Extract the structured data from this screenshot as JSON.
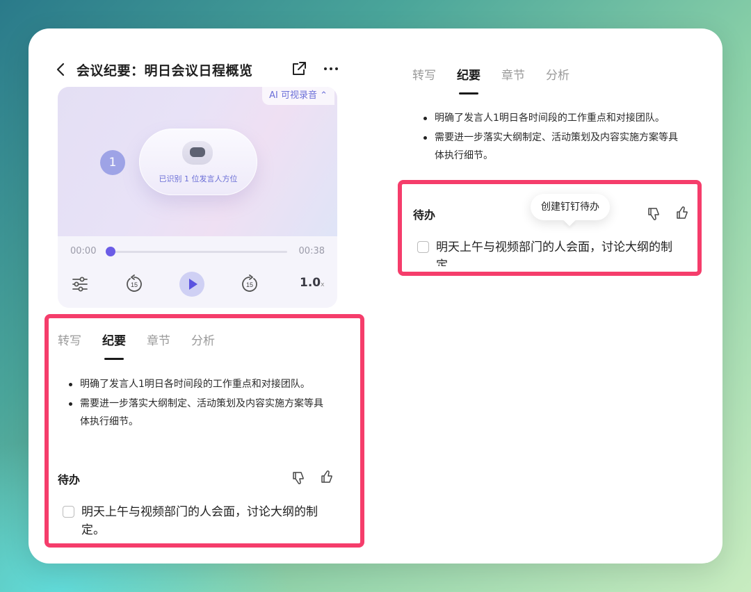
{
  "header": {
    "title": "会议纪要：明日会议日程概览"
  },
  "player": {
    "ai_chip": "AI 可视录音 ⌃",
    "speaker_number": "1",
    "speaker_status": "已识别 1 位发言人方位",
    "time_current": "00:00",
    "time_total": "00:38",
    "progress_fraction": 0.0,
    "speed": "1.0",
    "speed_unit": "x",
    "skip_back_seconds": "15",
    "skip_forward_seconds": "15"
  },
  "tabs": [
    "转写",
    "纪要",
    "章节",
    "分析"
  ],
  "active_tab": "纪要",
  "summary": {
    "bullets": [
      "明确了发言人1明日各时间段的工作重点和对接团队。",
      "需要进一步落实大纲制定、活动策划及内容实施方案等具体执行细节。"
    ]
  },
  "todo": {
    "heading": "待办",
    "item": "明天上午与视频部门的人会面，讨论大纲的制定。",
    "checked": false
  },
  "tooltip": {
    "text": "创建钉钉待办"
  },
  "colors": {
    "highlight": "#f53d6b",
    "accent": "#6b5ce6"
  }
}
